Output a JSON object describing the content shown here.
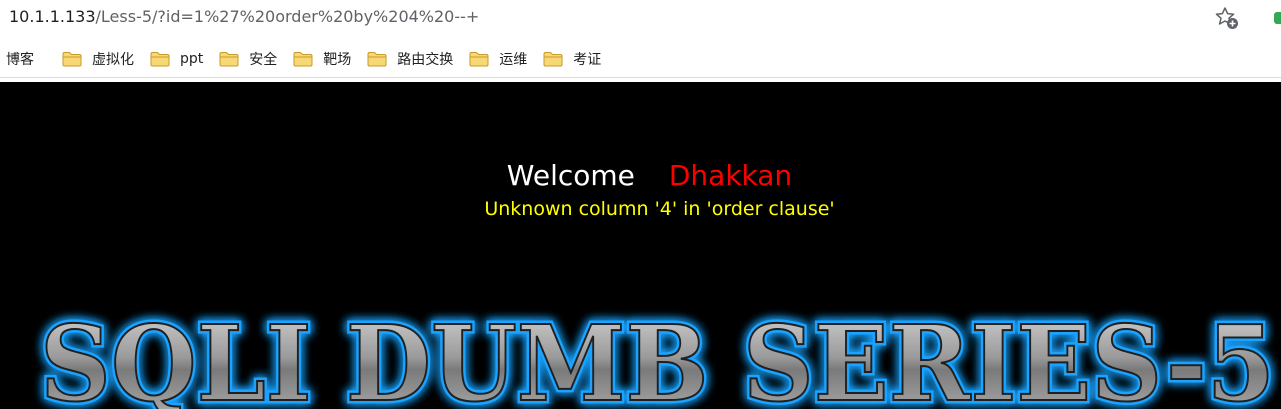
{
  "browser": {
    "url_host": "10.1.1.133",
    "url_path": "/Less-5/?id=1%27%20order%20by%204%20--+",
    "star_icon": "add-bookmark-star-icon"
  },
  "bookmarks": {
    "first": "博客",
    "items": [
      {
        "label": "虚拟化",
        "icon": "folder-icon"
      },
      {
        "label": "ppt",
        "icon": "folder-icon"
      },
      {
        "label": "安全",
        "icon": "folder-icon"
      },
      {
        "label": "靶场",
        "icon": "folder-icon"
      },
      {
        "label": "路由交换",
        "icon": "folder-icon"
      },
      {
        "label": "运维",
        "icon": "folder-icon"
      },
      {
        "label": "考证",
        "icon": "folder-icon"
      }
    ]
  },
  "page": {
    "welcome": "Welcome",
    "user": "Dhakkan",
    "error": "Unknown column '4' in 'order clause'",
    "banner_text": "SQLI DUMB SERIES-5",
    "colors": {
      "background": "#000000",
      "welcome": "#ffffff",
      "user": "#ff0000",
      "error": "#ffff00",
      "banner_glow": "#1aa3ff",
      "banner_fill": "#8c8c8c"
    }
  }
}
